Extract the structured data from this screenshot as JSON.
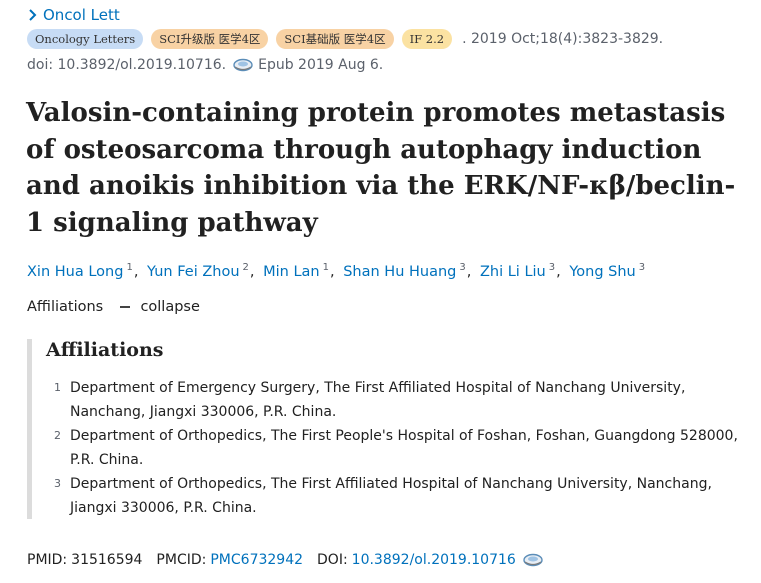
{
  "journal": {
    "name": "Oncol Lett"
  },
  "badges": [
    "Oncology Letters",
    "SCI升级版 医学4区",
    "SCI基础版 医学4区",
    "IF 2.2"
  ],
  "citation": ". 2019 Oct;18(4):3823-3829.",
  "doi_line": {
    "doi_text": "doi: 10.3892/ol.2019.10716.",
    "epub": "Epub 2019 Aug 6."
  },
  "title": "Valosin-containing protein promotes metastasis of osteosarcoma through autophagy induction and anoikis inhibition via the ERK/NF-κβ/beclin-1 signaling pathway",
  "authors": [
    {
      "name": "Xin Hua Long",
      "aff": "1"
    },
    {
      "name": "Yun Fei Zhou",
      "aff": "2"
    },
    {
      "name": "Min Lan",
      "aff": "1"
    },
    {
      "name": "Shan Hu Huang",
      "aff": "3"
    },
    {
      "name": "Zhi Li Liu",
      "aff": "3"
    },
    {
      "name": "Yong Shu",
      "aff": "3"
    }
  ],
  "affiliations_toggle": {
    "label": "Affiliations",
    "action": "collapse"
  },
  "affiliations": {
    "heading": "Affiliations",
    "items": [
      {
        "num": "1",
        "line1": "Department of Emergency Surgery, The First Affiliated Hospital of Nanchang University,",
        "line2": "Nanchang, Jiangxi 330006, P.R. China."
      },
      {
        "num": "2",
        "line1": "Department of Orthopedics, The First People's Hospital of Foshan, Foshan, Guangdong 528000,",
        "line2": "P.R. China."
      },
      {
        "num": "3",
        "line1": "Department of Orthopedics, The First Affiliated Hospital of Nanchang University, Nanchang,",
        "line2": "Jiangxi 330006, P.R. China."
      }
    ]
  },
  "ids": {
    "pmid_label": "PMID:",
    "pmid": "31516594",
    "pmcid_label": "PMCID:",
    "pmcid": "PMC6732942",
    "doi_label": "DOI:",
    "doi": "10.3892/ol.2019.10716"
  },
  "colors": {
    "link": "#0071bc",
    "badge_blue": "#c7dcf5",
    "badge_orange": "#f8d2a4",
    "badge_yellow": "#fbe2a2"
  },
  "icons": [
    "chevron-right-icon",
    "external-link-icon"
  ]
}
